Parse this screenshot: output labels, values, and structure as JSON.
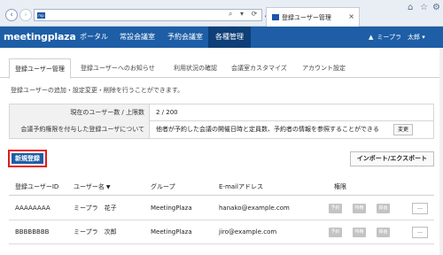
{
  "browser": {
    "tab_title": "登録ユーザー管理",
    "tab_close": "×",
    "back_icon": "‹",
    "forward_icon": "›",
    "address_favicon": "mp",
    "address_icons": "⌕ ▾ ⟳ ▲",
    "home_icon": "⌂",
    "star_icon": "☆",
    "gear_icon": "⚙"
  },
  "header": {
    "logo": "meetingplaza",
    "menu": [
      "ポータル",
      "常設会議室",
      "予約会議室",
      "各種管理"
    ],
    "active_menu": "各種管理",
    "user_menu": "ミープラ　太郎",
    "user_icon": "▲",
    "caret": "▾"
  },
  "subtabs": [
    "登録ユーザー管理",
    "登録ユーザーへのお知らせ",
    "利用状況の確認",
    "会議室カスタマイズ",
    "アカウント設定"
  ],
  "active_subtab": "登録ユーザー管理",
  "description": "登録ユーザーの追加・設定変更・削除を行うことができます。",
  "info": {
    "count_label": "現在のユーザー数 / 上限数",
    "count_value": "2 / 200",
    "perm_label": "会議予約権限を付与した登録ユーザについて",
    "perm_value": "他者が予約した会議の開催日時と定員数、予約者の情報を参照することができる",
    "change_button": "変更"
  },
  "actions": {
    "new_button": "新規登録",
    "import_button": "インポート/エクスポート"
  },
  "table": {
    "headers": [
      "登録ユーザーID",
      "ユーザー名",
      "グループ",
      "E-mailアドレス",
      "権限"
    ],
    "sort_icon": "▼",
    "permission_badges": [
      "予約",
      "特権",
      "録画"
    ],
    "more_button": "…",
    "rows": [
      {
        "id": "AAAAAAAA",
        "name": "ミープラ　花子",
        "group": "MeetingPlaza",
        "email": "hanako@example.com"
      },
      {
        "id": "BBBBBBBB",
        "name": "ミープラ　次郎",
        "group": "MeetingPlaza",
        "email": "jiro@example.com"
      }
    ]
  },
  "colors": {
    "brand_blue": "#1d5ea6",
    "active_menu_bg": "#0e3f78",
    "highlight_red": "#e31b1b",
    "badge_gray": "#c3c3c3"
  }
}
